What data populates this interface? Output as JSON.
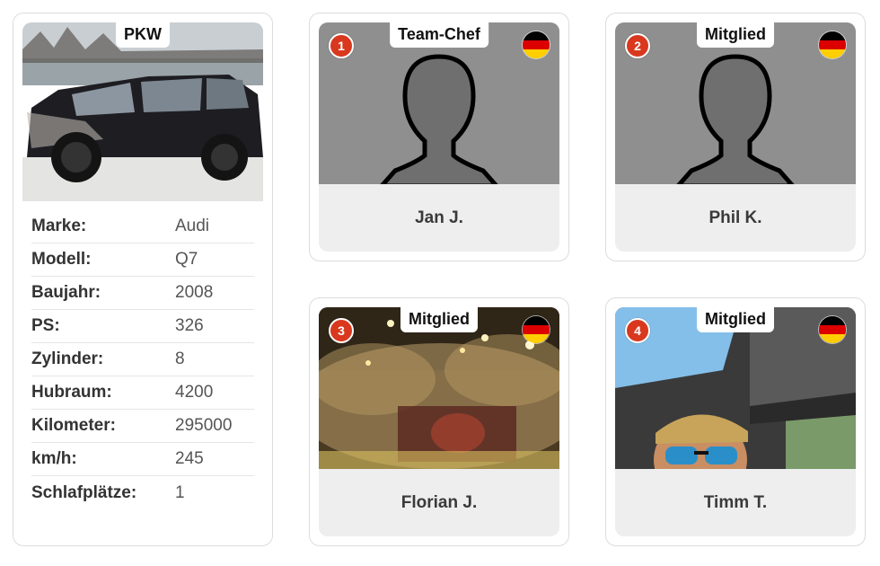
{
  "vehicle": {
    "tag": "PKW",
    "specs": [
      {
        "label": "Marke:",
        "value": "Audi"
      },
      {
        "label": "Modell:",
        "value": "Q7"
      },
      {
        "label": "Baujahr:",
        "value": "2008"
      },
      {
        "label": "PS:",
        "value": "326"
      },
      {
        "label": "Zylinder:",
        "value": "8"
      },
      {
        "label": "Hubraum:",
        "value": "4200"
      },
      {
        "label": "Kilometer:",
        "value": "295000"
      },
      {
        "label": "km/h:",
        "value": "245"
      },
      {
        "label": "Schlafplätze:",
        "value": "1"
      }
    ]
  },
  "members": [
    {
      "number": "1",
      "role": "Team-Chef",
      "name": "Jan J.",
      "photo": "placeholder-avatar",
      "flag": "germany-flag-icon"
    },
    {
      "number": "2",
      "role": "Mitglied",
      "name": "Phil K.",
      "photo": "placeholder-avatar",
      "flag": "germany-flag-icon"
    },
    {
      "number": "3",
      "role": "Mitglied",
      "name": "Florian J.",
      "photo": "concert-stage-photo",
      "flag": "germany-flag-icon"
    },
    {
      "number": "4",
      "role": "Mitglied",
      "name": "Timm T.",
      "photo": "car-selfie-photo",
      "flag": "germany-flag-icon"
    }
  ],
  "colors": {
    "badge": "#d9381e",
    "flag_black": "#000000",
    "flag_red": "#dd0000",
    "flag_gold": "#ffce00",
    "avatar_bg": "#8f8f8f",
    "avatar_silhouette": "#6f6f6f"
  }
}
